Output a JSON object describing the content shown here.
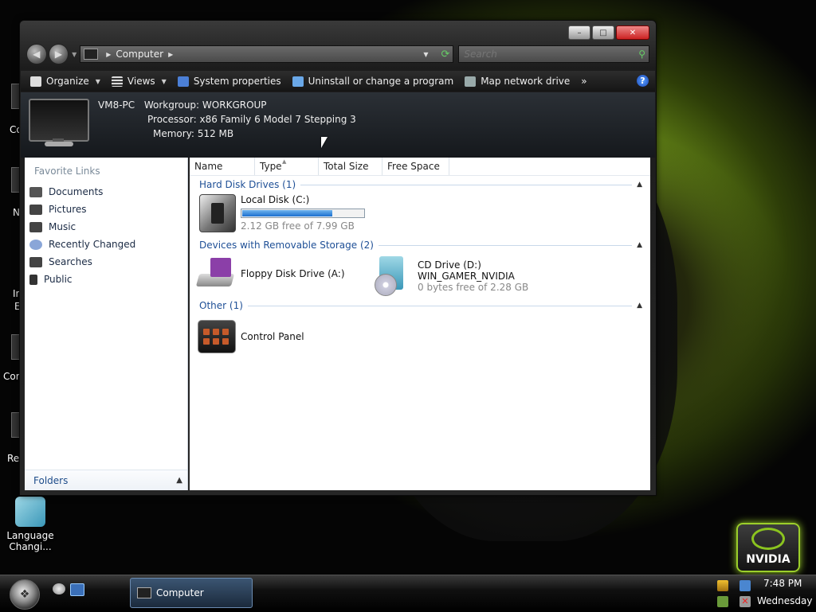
{
  "desktop": {
    "icons": [
      {
        "label": "Language Changi..."
      }
    ],
    "edge_labels": [
      "Co",
      "N",
      "In",
      "E",
      "Cor",
      "Re"
    ]
  },
  "window": {
    "address": {
      "location": "Computer"
    },
    "search": {
      "placeholder": "Search"
    },
    "toolbar": {
      "organize": "Organize",
      "views": "Views",
      "system_properties": "System properties",
      "uninstall": "Uninstall or change a program",
      "map_network_drive": "Map network drive",
      "more": "»",
      "help": "?"
    },
    "details": {
      "computer_name": "VM8-PC",
      "workgroup_label": "Workgroup:",
      "workgroup": "WORKGROUP",
      "processor_label": "Processor:",
      "processor": "x86 Family 6 Model 7 Stepping 3",
      "memory_label": "Memory:",
      "memory": "512 MB"
    },
    "nav_pane": {
      "favorite_links_title": "Favorite Links",
      "items": [
        "Documents",
        "Pictures",
        "Music",
        "Recently Changed",
        "Searches",
        "Public"
      ],
      "folders": "Folders"
    },
    "columns": [
      "Name",
      "Type",
      "Total Size",
      "Free Space"
    ],
    "groups": [
      {
        "title": "Hard Disk Drives (1)"
      },
      {
        "title": "Devices with Removable Storage (2)"
      },
      {
        "title": "Other (1)"
      }
    ],
    "drives": {
      "local_disk": {
        "name": "Local Disk (C:)",
        "free_text": "2.12 GB free of 7.99 GB",
        "used_fraction": 0.735
      },
      "floppy": {
        "name": "Floppy Disk Drive (A:)"
      },
      "cd": {
        "name": "CD Drive (D:)",
        "label": "WIN_GAMER_NVIDIA",
        "free_text": "0 bytes free of 2.28 GB"
      },
      "control_panel": {
        "name": "Control Panel"
      }
    }
  },
  "taskbar": {
    "active_window": "Computer",
    "time": "7:48 PM",
    "day": "Wednesday"
  },
  "nvidia_badge": "NVIDIA",
  "colors": {
    "accent_green": "#9ccf2b",
    "link_blue": "#1e4f96",
    "progress_blue": "#1b6fcf"
  }
}
